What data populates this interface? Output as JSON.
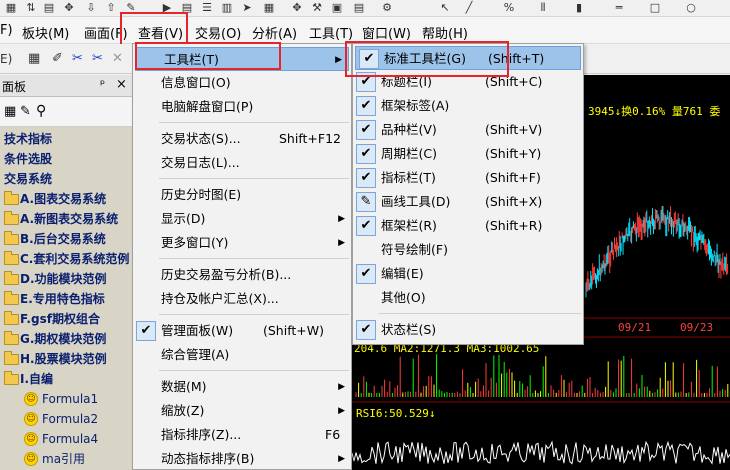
{
  "menubar": {
    "items": [
      "板块(M)",
      "画面(F)",
      "查看(V)",
      "交易(O)",
      "分析(A)",
      "工具(T)",
      "窗口(W)",
      "帮助(H)"
    ],
    "left_fragment": "F)"
  },
  "toolbar2": {
    "left_fragment": "E)"
  },
  "left_panel": {
    "title": "面板",
    "pin": "ᵖ",
    "close": "×",
    "tree": [
      {
        "label": "技术指标",
        "kind": "bold"
      },
      {
        "label": "条件选股",
        "kind": "bold"
      },
      {
        "label": "交易系统",
        "kind": "bold"
      },
      {
        "label": "A.图表交易系统",
        "kind": "folder"
      },
      {
        "label": "A.新图表交易系统",
        "kind": "folder"
      },
      {
        "label": "B.后台交易系统",
        "kind": "folder"
      },
      {
        "label": "C.套利交易系统范例",
        "kind": "folder"
      },
      {
        "label": "D.功能模块范例",
        "kind": "folder"
      },
      {
        "label": "E.专用特色指标",
        "kind": "folder"
      },
      {
        "label": "F.gsf期权组合",
        "kind": "folder"
      },
      {
        "label": "G.期权模块范例",
        "kind": "folder"
      },
      {
        "label": "H.股票模块范例",
        "kind": "folder"
      },
      {
        "label": "I.自编",
        "kind": "folder"
      },
      {
        "label": "Formula1",
        "kind": "formula"
      },
      {
        "label": "Formula2",
        "kind": "formula"
      },
      {
        "label": "Formula4",
        "kind": "formula"
      },
      {
        "label": "ma引用",
        "kind": "formula"
      }
    ]
  },
  "view_menu": {
    "items": [
      {
        "label": "工具栏(T)",
        "submenu": true,
        "highlighted": true
      },
      {
        "label": "信息窗口(O)"
      },
      {
        "label": "电脑解盘窗口(P)"
      },
      {
        "sep": true
      },
      {
        "label": "交易状态(S)...",
        "shortcut": "Shift+F12"
      },
      {
        "label": "交易日志(L)..."
      },
      {
        "sep": true
      },
      {
        "label": "历史分时图(E)"
      },
      {
        "label": "显示(D)",
        "submenu": true
      },
      {
        "label": "更多窗口(Y)",
        "submenu": true
      },
      {
        "sep": true
      },
      {
        "label": "历史交易盈亏分析(B)..."
      },
      {
        "label": "持仓及帐户汇总(X)..."
      },
      {
        "sep": true
      },
      {
        "label": "管理面板(W)",
        "shortcut": "(Shift+W)",
        "checked": true
      },
      {
        "label": "综合管理(A)"
      },
      {
        "sep": true
      },
      {
        "label": "数据(M)",
        "submenu": true
      },
      {
        "label": "缩放(Z)",
        "submenu": true
      },
      {
        "label": "指标排序(Z)...",
        "shortcut": "F6"
      },
      {
        "label": "动态指标排序(B)",
        "submenu": true
      }
    ]
  },
  "toolbar_submenu": {
    "items": [
      {
        "label": "标准工具栏(G)",
        "shortcut": "(Shift+T)",
        "checked": true,
        "highlighted": true
      },
      {
        "label": "标题栏(I)",
        "shortcut": "(Shift+C)",
        "checked": true
      },
      {
        "label": "框架标签(A)",
        "checked": true
      },
      {
        "label": "品种栏(V)",
        "shortcut": "(Shift+V)",
        "checked": true
      },
      {
        "label": "周期栏(C)",
        "shortcut": "(Shift+Y)",
        "checked": true
      },
      {
        "label": "指标栏(T)",
        "shortcut": "(Shift+F)",
        "checked": true
      },
      {
        "label": "画线工具(D)",
        "shortcut": "(Shift+X)",
        "checked": true,
        "icon": "pencil"
      },
      {
        "label": "框架栏(R)",
        "shortcut": "(Shift+R)",
        "checked": true
      },
      {
        "label": "符号绘制(F)"
      },
      {
        "label": "编辑(E)",
        "checked": true
      },
      {
        "label": "其他(O)"
      },
      {
        "sep": true
      },
      {
        "label": "状态栏(S)",
        "checked": true
      }
    ]
  },
  "chart": {
    "info_text": "3945↓换0.16% 量761 委",
    "date_labels": [
      "09/21",
      "09/23"
    ],
    "indicator_text": "204.6  MA2:1271.3  MA3:1002.65",
    "rsi_text": "RSI6:50.529↓",
    "colors": {
      "up": "#ff3b3b",
      "down": "#00e5ff",
      "text_yellow": "#ffff00",
      "grid": "#8b0000"
    }
  }
}
